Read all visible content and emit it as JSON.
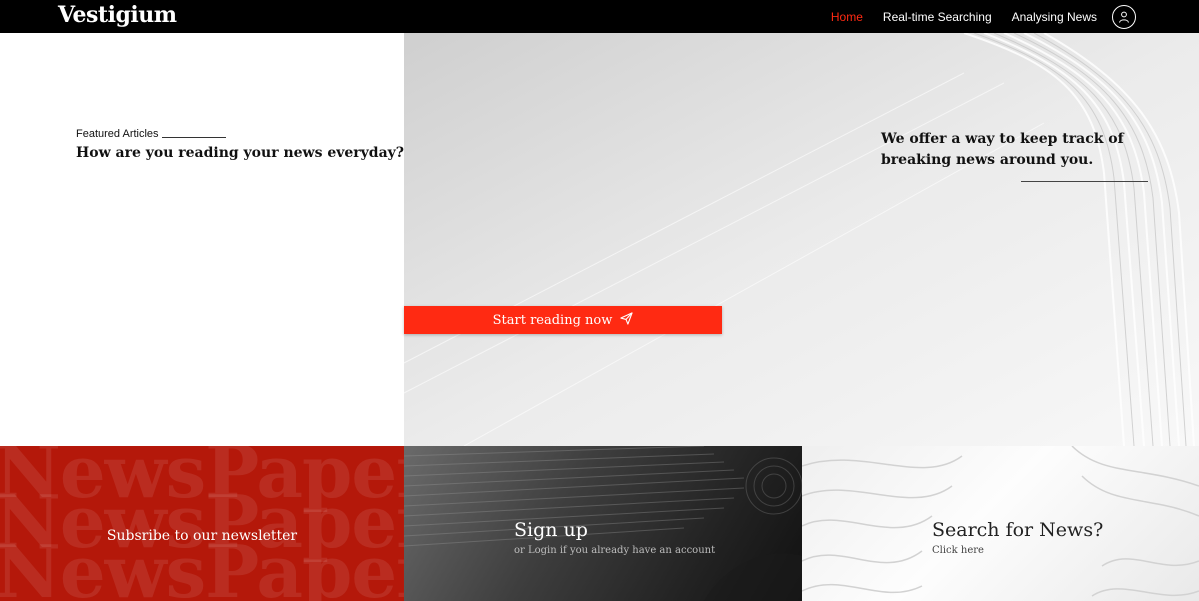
{
  "header": {
    "brand": "Vestigium",
    "nav": [
      {
        "label": "Home",
        "active": true
      },
      {
        "label": "Real-time Searching",
        "active": false
      },
      {
        "label": "Analysing News",
        "active": false
      }
    ],
    "avatar_icon": "user-avatar-icon"
  },
  "hero": {
    "featured_label": "Featured Articles",
    "left_headline": "How are you reading your news everyday?",
    "right_headline": "We offer a way to keep track of breaking news around you.",
    "cta_label": "Start reading now",
    "cta_icon": "paper-plane-icon"
  },
  "panels": {
    "newsletter": {
      "label": "Subsribe to our newsletter",
      "watermark": "NewsPaper"
    },
    "signup": {
      "title": "Sign up",
      "subtitle": "or Login if you already have an account"
    },
    "search": {
      "title": "Search for News?",
      "subtitle": "Click here"
    }
  },
  "colors": {
    "accent": "#ff2a12",
    "navbar": "#000000",
    "newsletter_bg": "#b4180a"
  }
}
